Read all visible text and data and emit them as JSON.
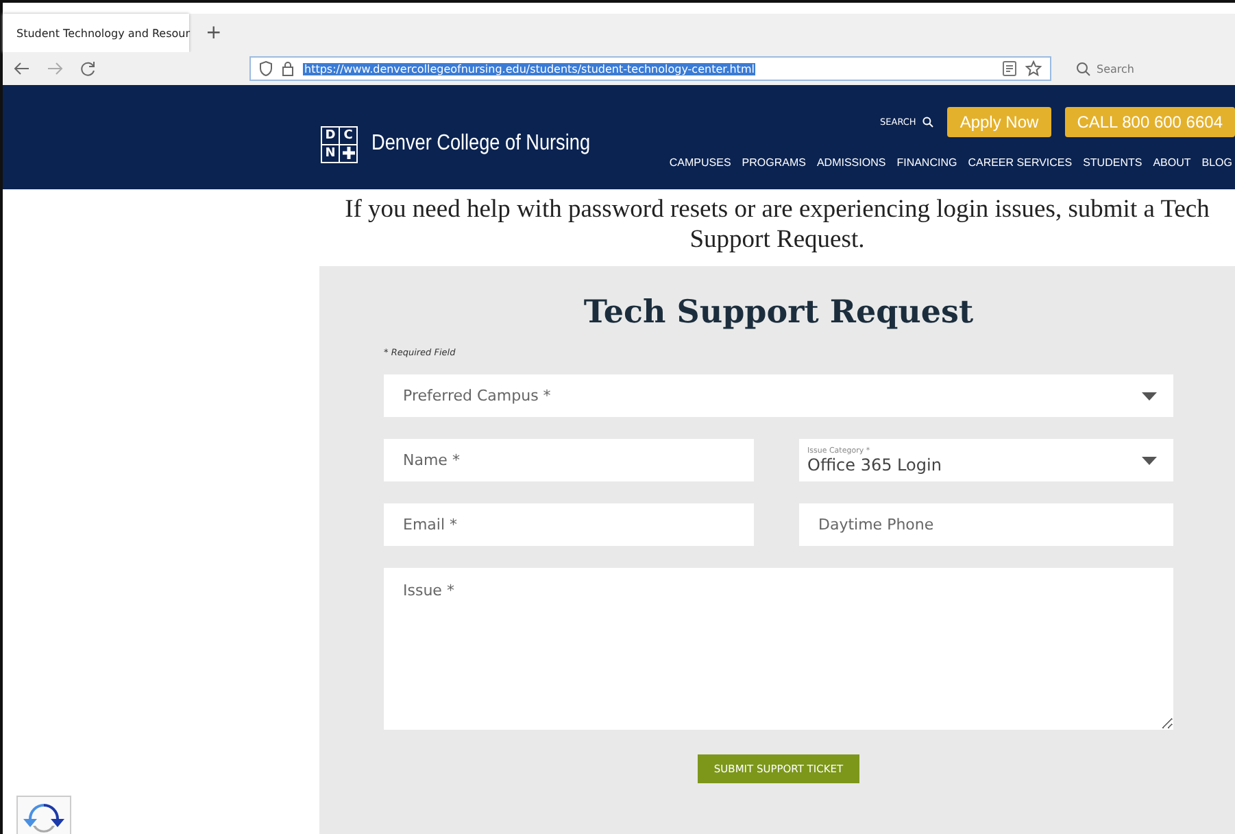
{
  "browser": {
    "tab": {
      "title": "Student Technology and Resour",
      "selected": true
    },
    "new_tab": "+",
    "url": "https://www.denvercollegeofnursing.edu/students/student-technology-center.html",
    "search": {
      "placeholder": "Search"
    }
  },
  "header": {
    "logo_letters": [
      "D",
      "C",
      "N"
    ],
    "site_name": "Denver College of Nursing",
    "search_label": "SEARCH",
    "apply_button": "Apply Now",
    "call_button": "CALL 800 600 6604",
    "nav": [
      "CAMPUSES",
      "PROGRAMS",
      "ADMISSIONS",
      "FINANCING",
      "CAREER SERVICES",
      "STUDENTS",
      "ABOUT",
      "BLOG"
    ]
  },
  "intro": "If you need help with password resets or are experiencing login issues, submit a Tech Support Request.",
  "form": {
    "title": "Tech Support Request",
    "required_note": "* Required Field",
    "fields": [
      {
        "kind": "wideselect",
        "placeholder": "Preferred Campus *"
      },
      {
        "kind": "text",
        "placeholder": "Name *"
      },
      {
        "kind": "select",
        "label": "Issue Category *",
        "value": "Office 365 Login"
      },
      {
        "kind": "text",
        "placeholder": "Email *"
      },
      {
        "kind": "text",
        "placeholder": "Daytime Phone"
      },
      {
        "kind": "textarea",
        "placeholder": "Issue *"
      }
    ],
    "submit": "SUBMIT SUPPORT TICKET"
  }
}
